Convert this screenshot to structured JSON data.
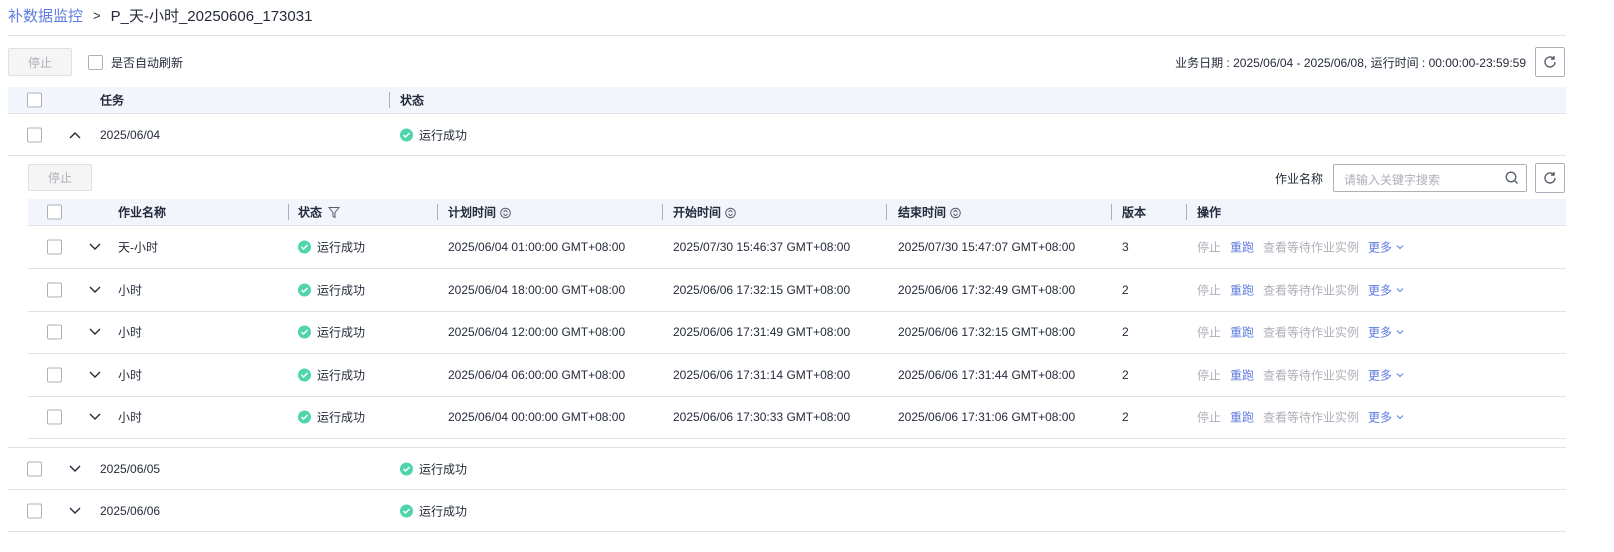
{
  "breadcrumb": {
    "parent": "补数据监控",
    "separator": ">",
    "current": "P_天-小时_20250606_173031"
  },
  "toolbar": {
    "stop_label": "停止",
    "auto_refresh_label": "是否自动刷新",
    "info": "业务日期 : 2025/06/04 - 2025/06/08, 运行时间 : 00:00:00-23:59:59"
  },
  "outer_table": {
    "headers": {
      "task": "任务",
      "status": "状态"
    },
    "groups": [
      {
        "date": "2025/06/04",
        "status": "运行成功",
        "expanded": true
      },
      {
        "date": "2025/06/05",
        "status": "运行成功",
        "expanded": false
      },
      {
        "date": "2025/06/06",
        "status": "运行成功",
        "expanded": false
      }
    ]
  },
  "inner": {
    "stop_label": "停止",
    "search_label": "作业名称",
    "search_placeholder": "请输入关键字搜索",
    "headers": {
      "name": "作业名称",
      "status": "状态",
      "plan": "计划时间",
      "start": "开始时间",
      "end": "结束时间",
      "version": "版本",
      "ops": "操作"
    },
    "ops": {
      "stop": "停止",
      "rerun": "重跑",
      "view": "查看等待作业实例",
      "more": "更多"
    },
    "rows": [
      {
        "name": "天-小时",
        "status": "运行成功",
        "plan": "2025/06/04 01:00:00 GMT+08:00",
        "start": "2025/07/30 15:46:37 GMT+08:00",
        "end": "2025/07/30 15:47:07 GMT+08:00",
        "version": "3"
      },
      {
        "name": "小时",
        "status": "运行成功",
        "plan": "2025/06/04 18:00:00 GMT+08:00",
        "start": "2025/06/06 17:32:15 GMT+08:00",
        "end": "2025/06/06 17:32:49 GMT+08:00",
        "version": "2"
      },
      {
        "name": "小时",
        "status": "运行成功",
        "plan": "2025/06/04 12:00:00 GMT+08:00",
        "start": "2025/06/06 17:31:49 GMT+08:00",
        "end": "2025/06/06 17:32:15 GMT+08:00",
        "version": "2"
      },
      {
        "name": "小时",
        "status": "运行成功",
        "plan": "2025/06/04 06:00:00 GMT+08:00",
        "start": "2025/06/06 17:31:14 GMT+08:00",
        "end": "2025/06/06 17:31:44 GMT+08:00",
        "version": "2"
      },
      {
        "name": "小时",
        "status": "运行成功",
        "plan": "2025/06/04 00:00:00 GMT+08:00",
        "start": "2025/06/06 17:30:33 GMT+08:00",
        "end": "2025/06/06 17:31:06 GMT+08:00",
        "version": "2"
      }
    ]
  },
  "colors": {
    "accent": "#5e7ce0",
    "success": "#50d4ab",
    "header_bg": "#f2f5fc"
  }
}
